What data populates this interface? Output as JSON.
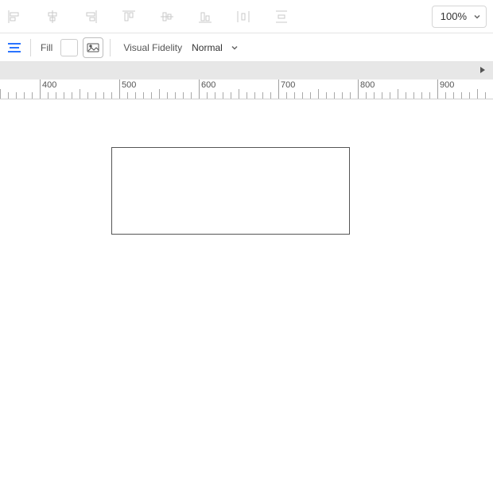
{
  "toolbar": {
    "zoom": "100%"
  },
  "subbar": {
    "fill_label": "Fill",
    "vf_label": "Visual Fidelity",
    "vf_value": "Normal"
  },
  "ruler": {
    "start": 350,
    "step": 100,
    "labels": [
      "400",
      "500",
      "600",
      "700",
      "800",
      "900"
    ]
  }
}
